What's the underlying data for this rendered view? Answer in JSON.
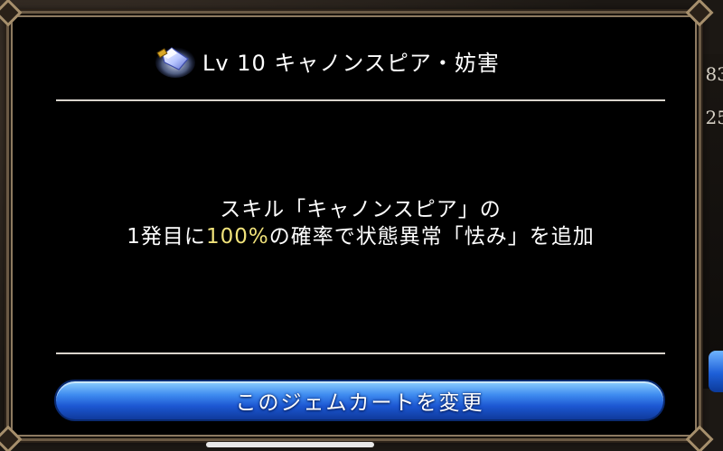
{
  "dialog": {
    "title": "Lv 10 キャノンスピア・妨害",
    "icon": "gem-icon",
    "description": {
      "line1": "スキル「キャノンスピア」の",
      "line2_before": "1発目に",
      "line2_highlight": "100%",
      "line2_after": "の確率で状態異常「怯み」を追加"
    },
    "button_label": "このジェムカートを変更"
  },
  "background": {
    "right_values": [
      "83",
      "25"
    ]
  },
  "colors": {
    "highlight": "#f0e27a",
    "button": "#1c57d2",
    "frame": "#6b5a45"
  }
}
